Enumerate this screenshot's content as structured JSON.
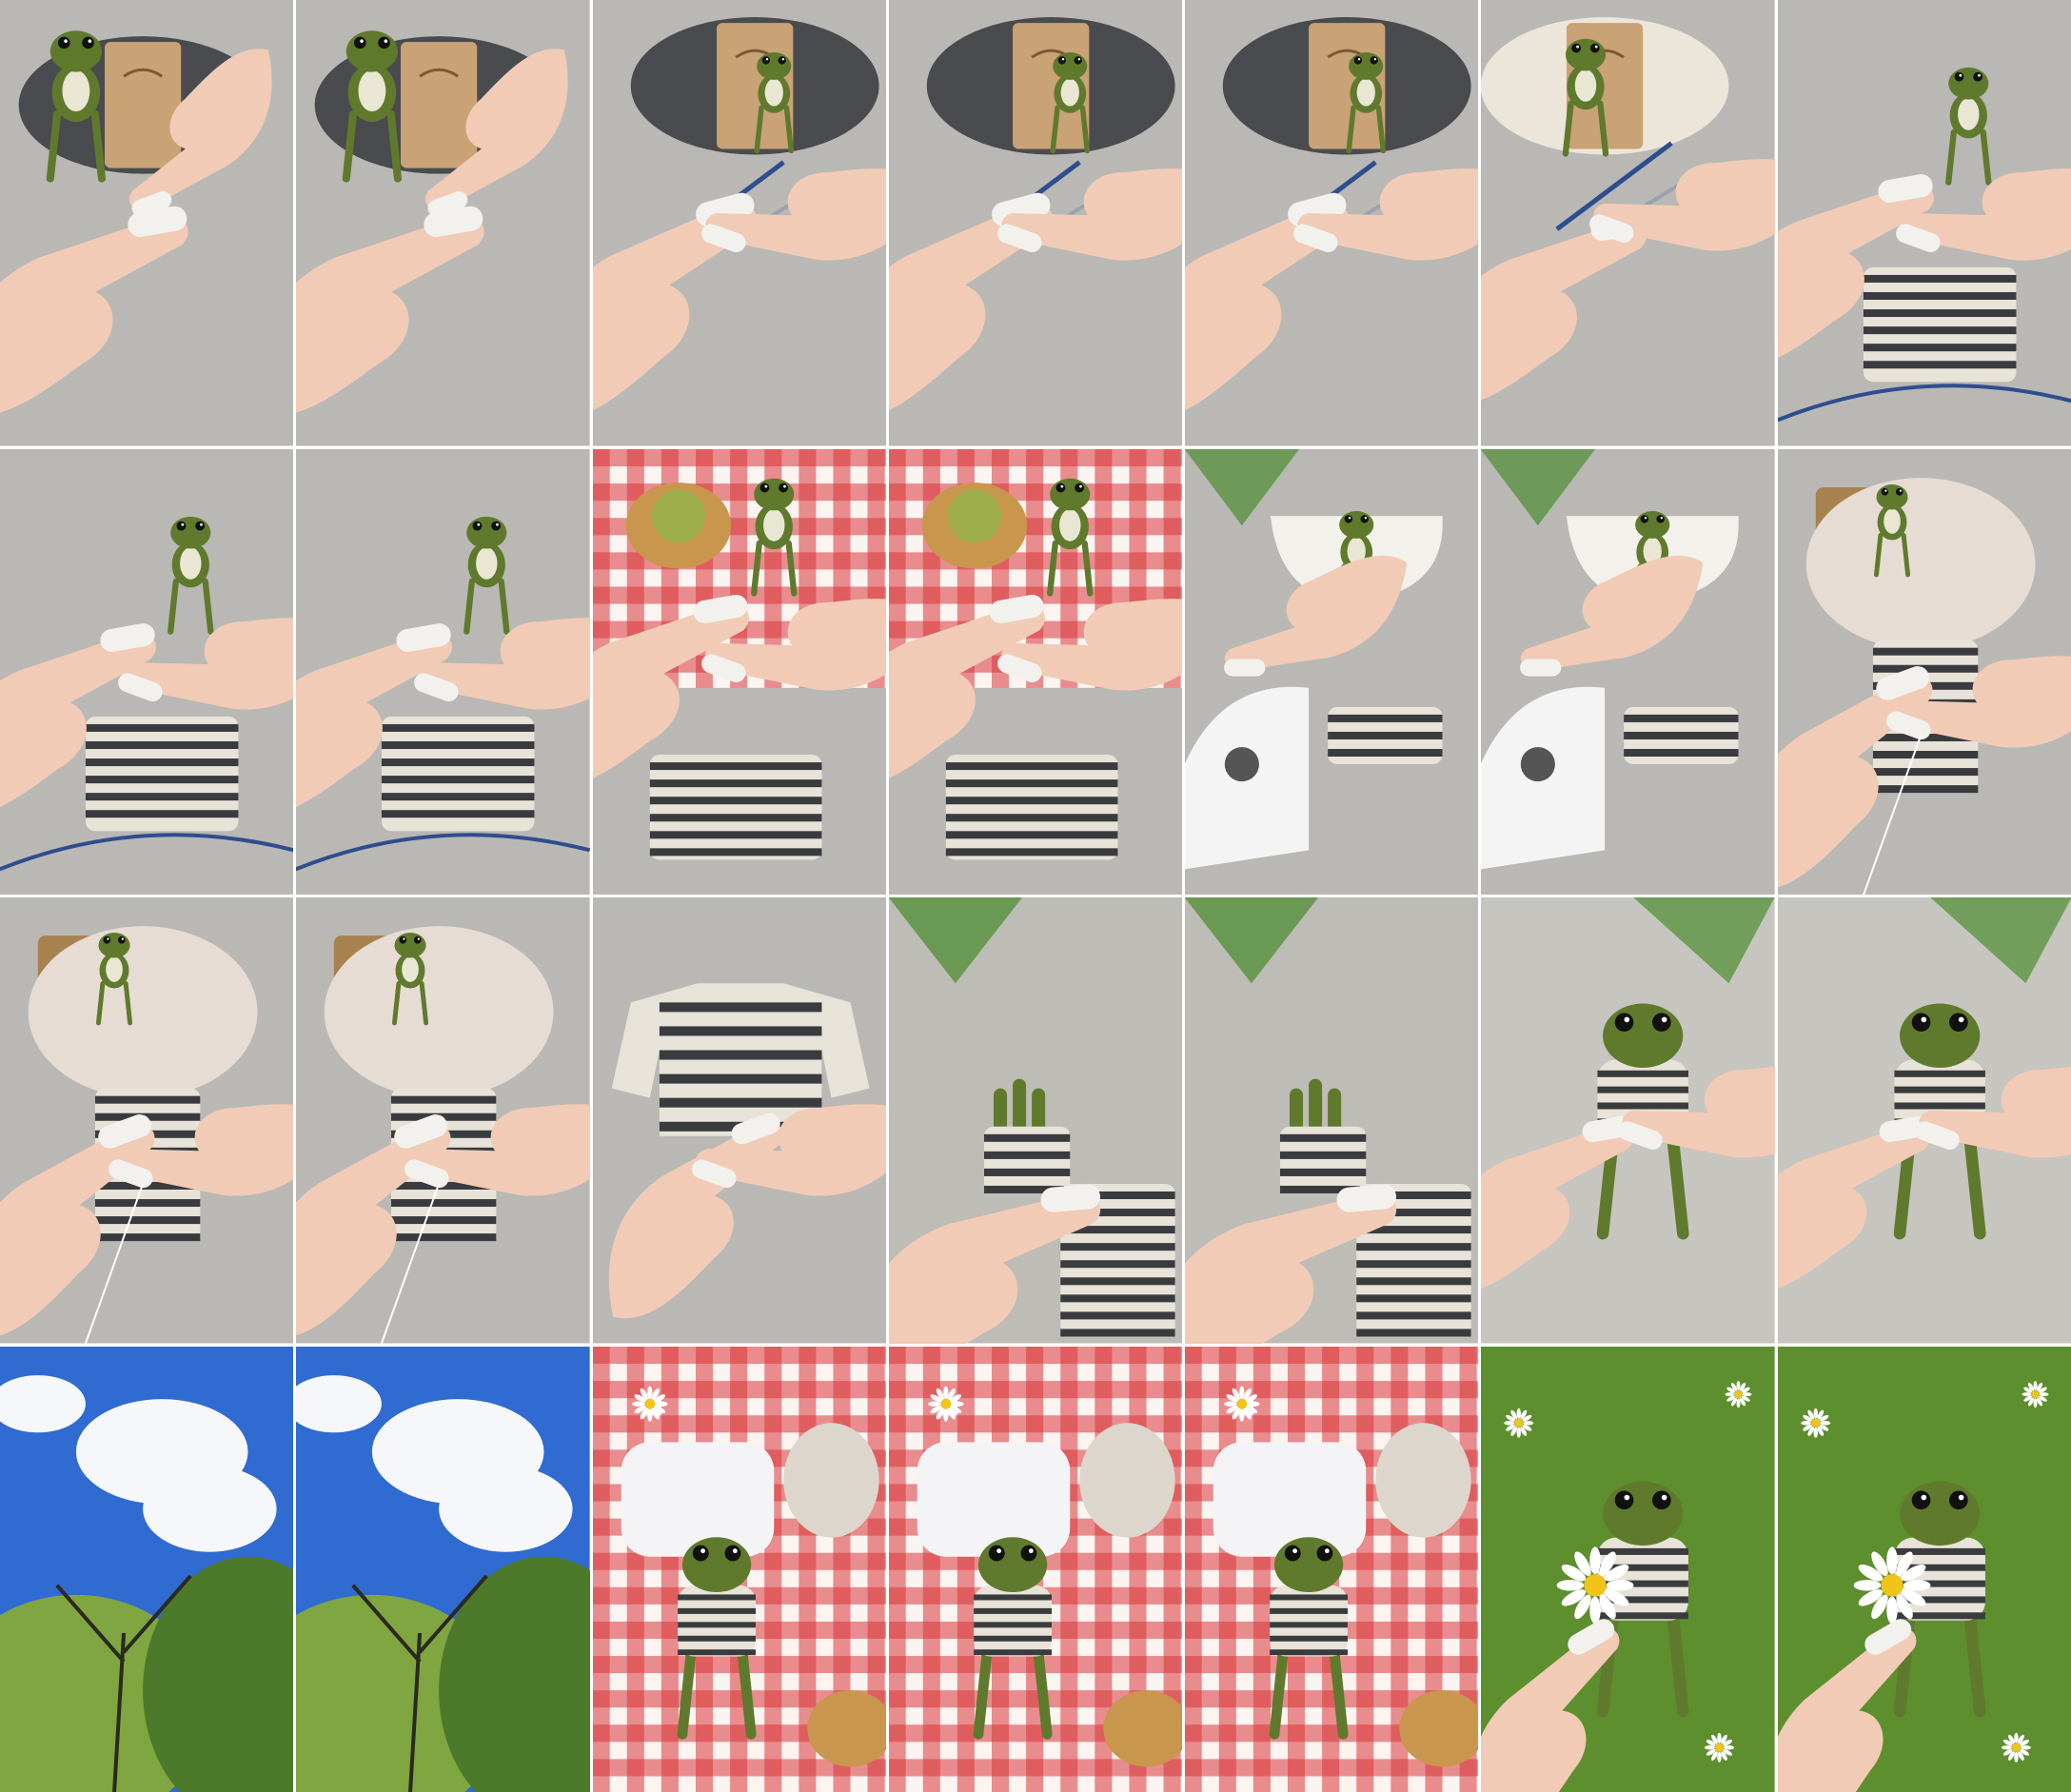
{
  "collage": {
    "columns": 7,
    "rows": 4,
    "colors": {
      "felt_gray": "#b9b8b4",
      "yarn_dark": "#4a4b4f",
      "yarn_cream": "#ece6da",
      "label_kraft": "#c9a275",
      "frog_green": "#5f7a2c",
      "frog_belly": "#e9e6d4",
      "skin": "#f1cbb6",
      "nail": "#f2f1ee",
      "stripe_dark": "#3a3b3f",
      "stripe_light": "#e8e3d8",
      "gingham_red": "#d9363a",
      "gingham_white": "#fbf4f1",
      "grass": "#5e8f2e",
      "sky_blue": "#2f6bd1",
      "cloud": "#f6f7fb",
      "tree_green": "#7fa640",
      "basket": "#c8964c",
      "daisy_white": "#ffffff",
      "daisy_yellow": "#f0c419",
      "iron_white": "#f4f4f4",
      "tub_white": "#f3f1ec",
      "rose": "#7d1f2a",
      "fern": "#4f8d32"
    },
    "frames": [
      {
        "scene": "knit-start-dark"
      },
      {
        "scene": "knit-start-dark"
      },
      {
        "scene": "knit-needles-dark"
      },
      {
        "scene": "knit-needles-dark"
      },
      {
        "scene": "knit-needles-dark"
      },
      {
        "scene": "knit-needles-cream"
      },
      {
        "scene": "knit-piece"
      },
      {
        "scene": "knit-piece"
      },
      {
        "scene": "knit-piece"
      },
      {
        "scene": "picnic-knit"
      },
      {
        "scene": "picnic-knit"
      },
      {
        "scene": "iron-tub"
      },
      {
        "scene": "iron-tub"
      },
      {
        "scene": "sew-sleeve"
      },
      {
        "scene": "sew-sleeve"
      },
      {
        "scene": "sew-sleeve"
      },
      {
        "scene": "sweater-hold"
      },
      {
        "scene": "frog-hand"
      },
      {
        "scene": "frog-hand"
      },
      {
        "scene": "frog-dressed"
      },
      {
        "scene": "frog-dressed"
      },
      {
        "scene": "sky-trees"
      },
      {
        "scene": "sky-trees"
      },
      {
        "scene": "picnic-frog"
      },
      {
        "scene": "picnic-frog"
      },
      {
        "scene": "picnic-frog"
      },
      {
        "scene": "daisy-frog"
      },
      {
        "scene": "daisy-frog"
      }
    ]
  }
}
